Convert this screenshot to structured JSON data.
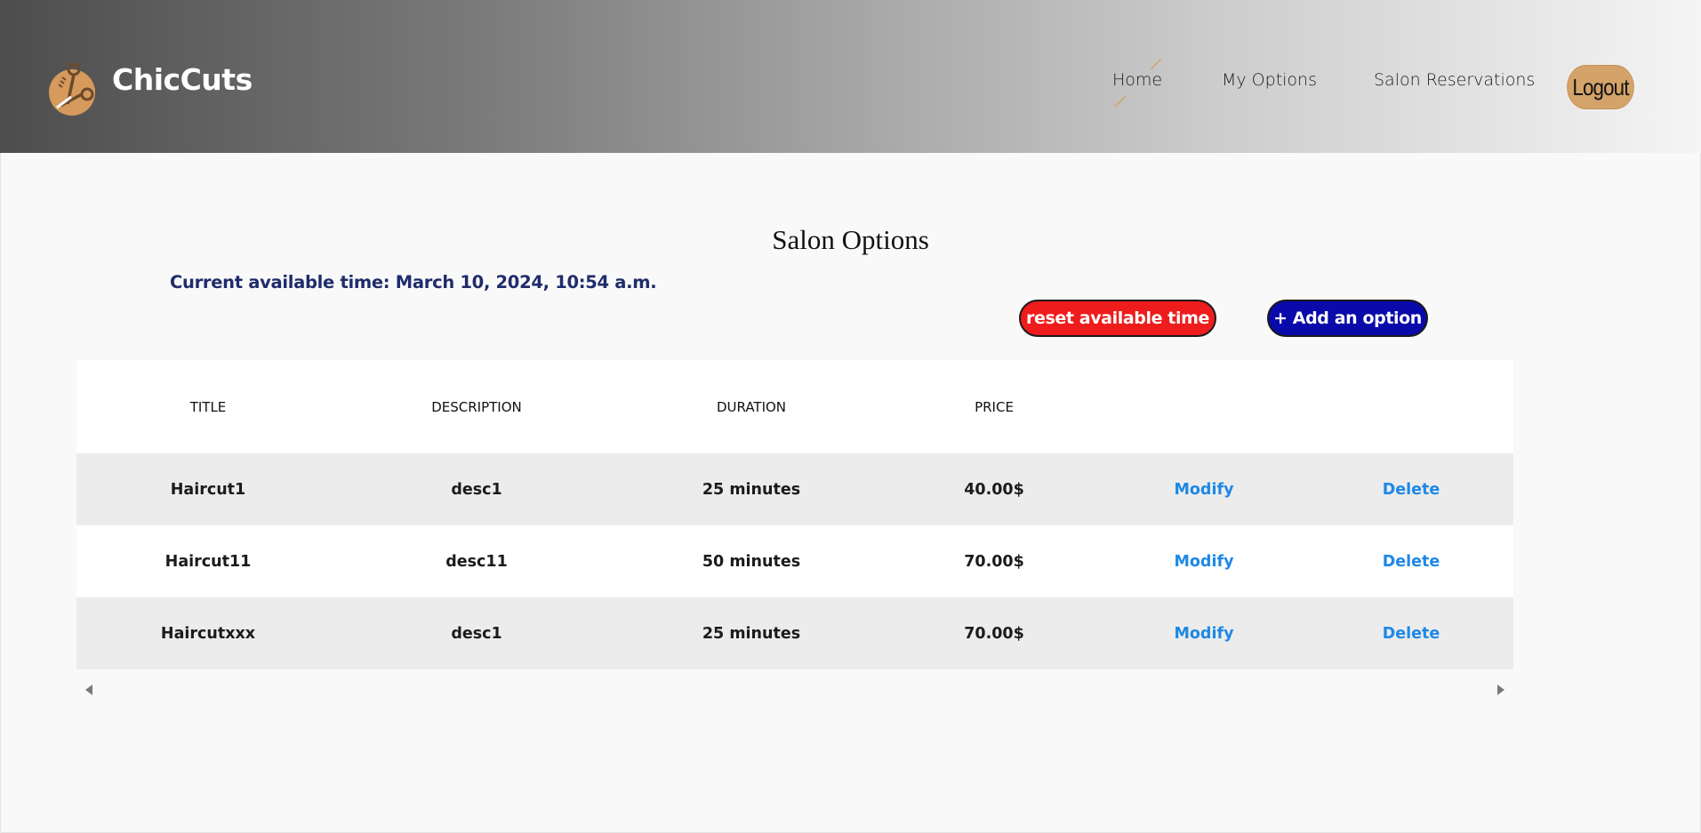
{
  "header": {
    "brand": "ChicCuts",
    "logo_icon": "scissors-comb-icon",
    "nav": [
      "Home",
      "My Options",
      "Salon Reservations"
    ],
    "logout_label": "Logout",
    "accent_color": "#d4a36a"
  },
  "main": {
    "title": "Salon Options",
    "available_time": "Current available time: March 10, 2024, 10:54 a.m.",
    "reset_button": "reset available time",
    "add_button": "+ Add an option",
    "reset_color": "#ee1c1c",
    "add_color": "#0a0aaa"
  },
  "table": {
    "headers": [
      "TITLE",
      "DESCRIPTION",
      "DURATION",
      "PRICE"
    ],
    "rows": [
      {
        "title": "Haircut1",
        "description": "desc1",
        "duration": "25 minutes",
        "price": "40.00$",
        "modify": "Modify",
        "delete": "Delete"
      },
      {
        "title": "Haircut11",
        "description": "desc11",
        "duration": "50 minutes",
        "price": "70.00$",
        "modify": "Modify",
        "delete": "Delete"
      },
      {
        "title": "Haircutxxx",
        "description": "desc1",
        "duration": "25 minutes",
        "price": "70.00$",
        "modify": "Modify",
        "delete": "Delete"
      }
    ],
    "link_color": "#1e88e5"
  }
}
